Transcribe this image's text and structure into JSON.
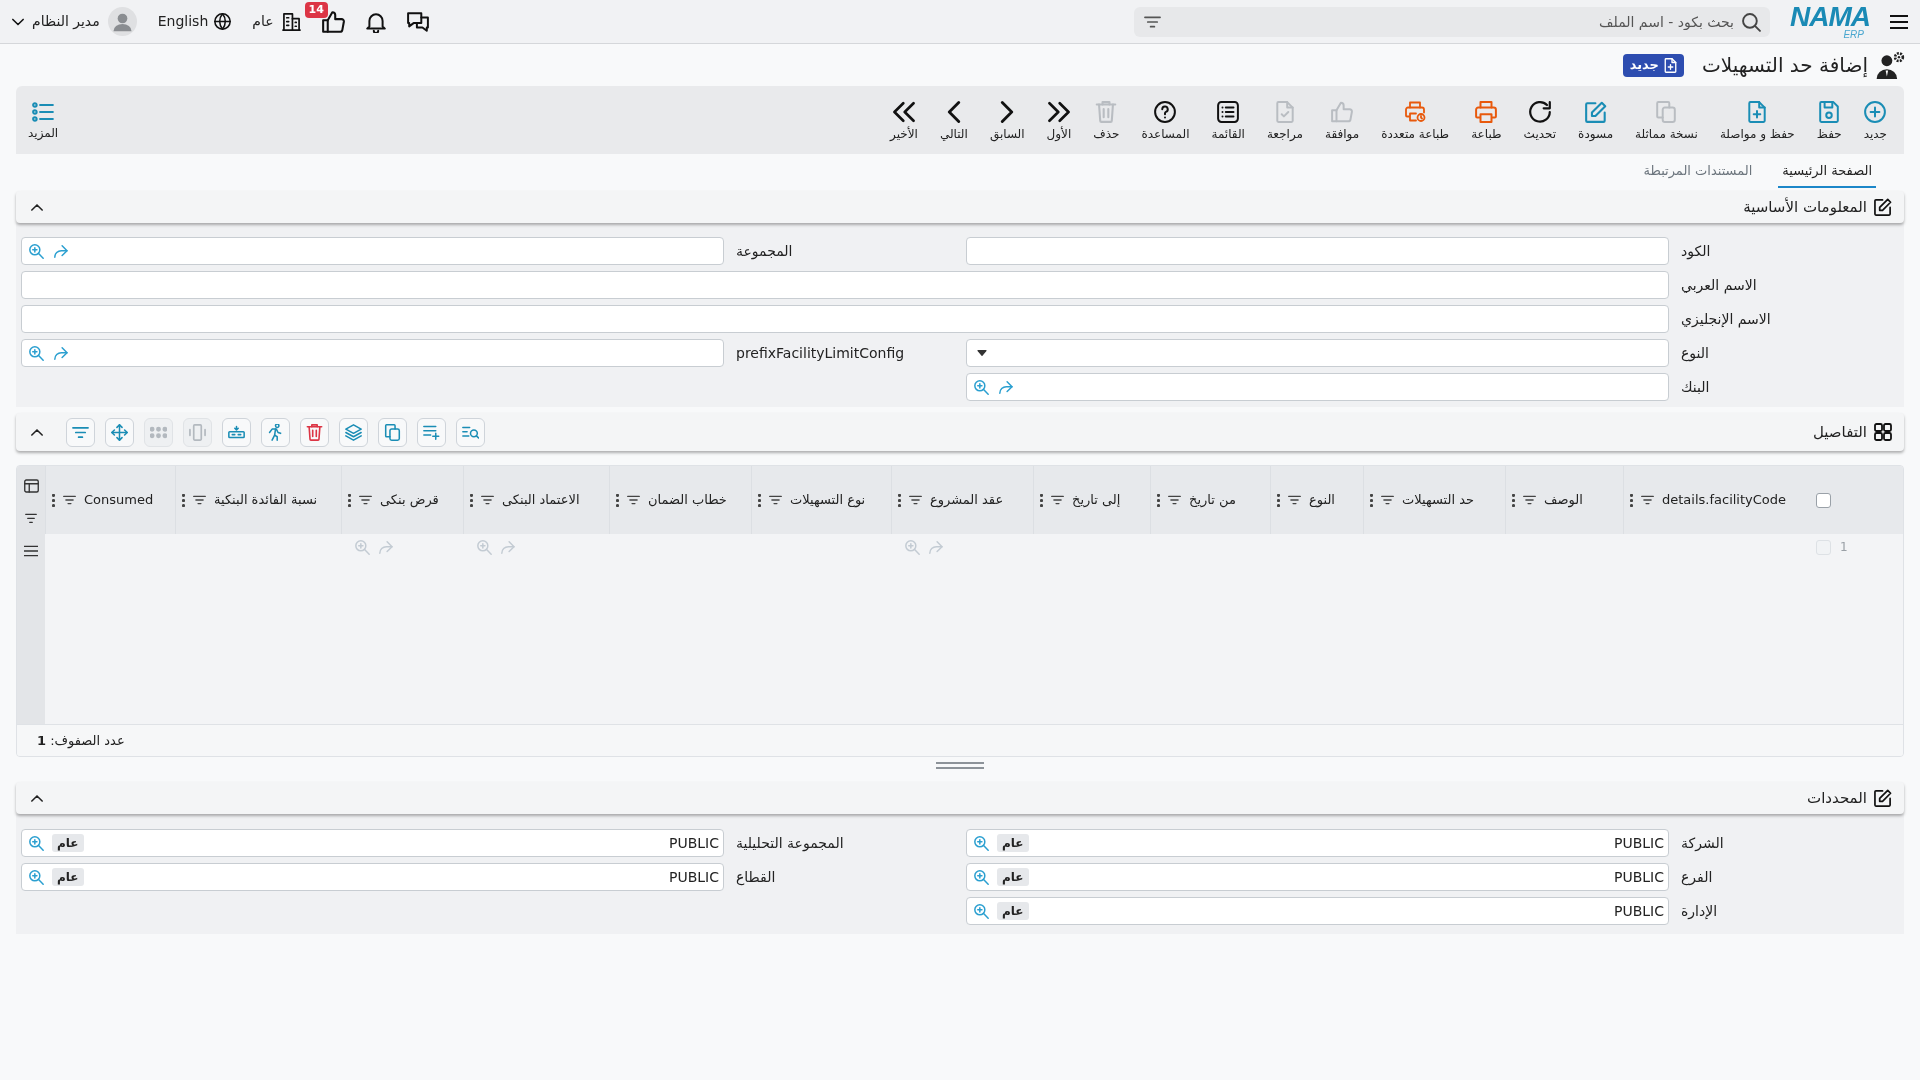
{
  "top_bar": {
    "logo": {
      "name": "NAMA",
      "tagline": "ERP"
    },
    "search": {
      "placeholder": "بحث بكود - اسم الملف"
    },
    "notifications": {
      "count": "14"
    },
    "company": "عام",
    "language": "English",
    "user": "مدير النظام"
  },
  "page": {
    "title": "إضافة حد التسهيلات",
    "status": "جديد"
  },
  "toolbar": {
    "buttons": [
      {
        "kind": "new",
        "label": "جديد",
        "disabled": false
      },
      {
        "kind": "save",
        "label": "حفظ",
        "disabled": false
      },
      {
        "kind": "savecontinue",
        "label": "حفظ و مواصلة",
        "disabled": false
      },
      {
        "kind": "duplicate",
        "label": "نسخة مماثلة",
        "disabled": true
      },
      {
        "kind": "draft",
        "label": "مسودة",
        "disabled": false
      },
      {
        "kind": "refresh",
        "label": "تحديث",
        "disabled": false
      },
      {
        "kind": "print",
        "label": "طباعة",
        "disabled": false
      },
      {
        "kind": "multiprint",
        "label": "طباعة متعددة",
        "disabled": false
      },
      {
        "kind": "approve",
        "label": "موافقة",
        "disabled": true
      },
      {
        "kind": "review",
        "label": "مراجعة",
        "disabled": true
      },
      {
        "kind": "list",
        "label": "القائمة",
        "disabled": false
      },
      {
        "kind": "help",
        "label": "المساعدة",
        "disabled": false
      },
      {
        "kind": "delete",
        "label": "حذف",
        "disabled": true
      },
      {
        "kind": "first",
        "label": "الأول",
        "disabled": false
      },
      {
        "kind": "previous",
        "label": "السابق",
        "disabled": false
      },
      {
        "kind": "next",
        "label": "التالي",
        "disabled": false
      },
      {
        "kind": "last",
        "label": "الأخير",
        "disabled": false
      }
    ],
    "more": {
      "label": "المزيد"
    }
  },
  "tabs": [
    {
      "label": "الصفحة الرئيسية",
      "selected": true
    },
    {
      "label": "المستندات المرتبطة",
      "selected": false
    }
  ],
  "basic_info": {
    "title": "المعلومات الأساسية",
    "expanded": true,
    "fields": [
      {
        "kind": "text",
        "label": "الكود"
      },
      {
        "kind": "lookup",
        "label": "المجموعة"
      },
      {
        "kind": "wide",
        "label": "الاسم العربي"
      },
      {
        "kind": "wide",
        "label": "الاسم الإنجليزي"
      },
      {
        "kind": "select",
        "label": "النوع"
      },
      {
        "kind": "lookup",
        "label": "prefixFacilityLimitConfig"
      },
      {
        "kind": "lookup",
        "label": "البنك"
      }
    ]
  },
  "details": {
    "title": "التفاصيل",
    "expanded": true,
    "tools": [
      {
        "kind": "search",
        "disabled": false
      },
      {
        "kind": "addrow",
        "disabled": false
      },
      {
        "kind": "copy",
        "disabled": false
      },
      {
        "kind": "layers",
        "disabled": false
      },
      {
        "kind": "delete",
        "disabled": false
      },
      {
        "kind": "run",
        "disabled": false
      },
      {
        "kind": "insert",
        "disabled": false
      },
      {
        "kind": "resize",
        "disabled": true
      },
      {
        "kind": "grid",
        "disabled": true
      },
      {
        "kind": "move",
        "disabled": false
      },
      {
        "kind": "filter",
        "disabled": false
      }
    ],
    "grid": {
      "select_all": {
        "checked": false
      },
      "columns": [
        {
          "kind": "text",
          "label": "details.facilityCode"
        },
        {
          "kind": "text",
          "label": "الوصف"
        },
        {
          "kind": "text",
          "label": "حد التسهيلات"
        },
        {
          "kind": "text",
          "label": "النوع"
        },
        {
          "kind": "text",
          "label": "من تاريخ"
        },
        {
          "kind": "text",
          "label": "إلى تاريخ"
        },
        {
          "kind": "lookup",
          "label": "عقد المشروع"
        },
        {
          "kind": "text",
          "label": "نوع التسهيلات"
        },
        {
          "kind": "text",
          "label": "خطاب الضمان"
        },
        {
          "kind": "lookup",
          "label": "الاعتماد البنكى"
        },
        {
          "kind": "lookup",
          "label": "قرض بنكى"
        },
        {
          "kind": "text",
          "label": "نسبة الفائدة البنكية"
        },
        {
          "kind": "text",
          "label": "Consumed"
        }
      ],
      "rows": [
        {
          "number": "1",
          "checked": false
        }
      ],
      "row_count": "عدد الصفوف: **1**"
    }
  },
  "dimensions": {
    "title": "المحددات",
    "expanded": true,
    "fields": [
      {
        "label": "الشركة",
        "value": "PUBLIC",
        "tag": "عام"
      },
      {
        "label": "المجموعة التحليلية",
        "value": "PUBLIC",
        "tag": "عام"
      },
      {
        "label": "الفرع",
        "value": "PUBLIC",
        "tag": "عام"
      },
      {
        "label": "القطاع",
        "value": "PUBLIC",
        "tag": "عام"
      },
      {
        "label": "الإدارة",
        "value": "PUBLIC",
        "tag": "عام"
      }
    ]
  }
}
